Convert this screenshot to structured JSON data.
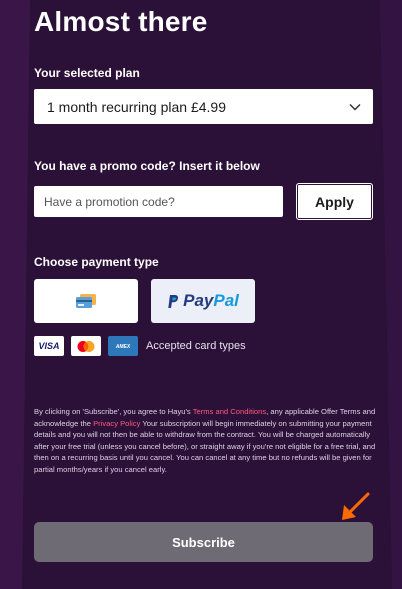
{
  "page": {
    "title": "Almost there"
  },
  "plan": {
    "label": "Your selected plan",
    "selected": "1 month recurring plan £4.99"
  },
  "promo": {
    "label": "You have a promo code? Insert it below",
    "placeholder": "Have a promotion code?",
    "value": "",
    "apply_label": "Apply"
  },
  "payment": {
    "label": "Choose payment type",
    "options": [
      {
        "type": "card",
        "icon": "credit-card-icon"
      },
      {
        "type": "paypal",
        "text_a": "Pay",
        "text_b": "Pal",
        "icon": "paypal-logo"
      }
    ],
    "cards": [
      {
        "name": "VISA",
        "icon": "visa-icon"
      },
      {
        "name": "Mastercard",
        "icon": "mastercard-icon"
      },
      {
        "name": "AMERICAN EXPRESS",
        "icon": "amex-icon"
      }
    ],
    "accepted_label": "Accepted card types"
  },
  "legal": {
    "part1": "By clicking on 'Subscribe', you agree to Hayu's ",
    "terms_link": "Terms and Conditions",
    "part2": ", any applicable Offer Terms and acknowledge the ",
    "privacy_link": "Privacy Policy",
    "part3": " Your subscription will begin immediately on submitting your payment details and you will not then be able to withdraw from the contract. You will be charged automatically after your free trial (unless you cancel before), or straight away if you're not eligible for a free trial, and then on a recurring basis until you cancel. You can cancel at any time but no refunds will be given for partial months/years if you cancel early."
  },
  "subscribe": {
    "label": "Subscribe"
  },
  "colors": {
    "background": "#2b1038",
    "accent_link": "#ff5a7e",
    "arrow": "#ff6a00",
    "subscribe_bg": "#6f6b74"
  }
}
